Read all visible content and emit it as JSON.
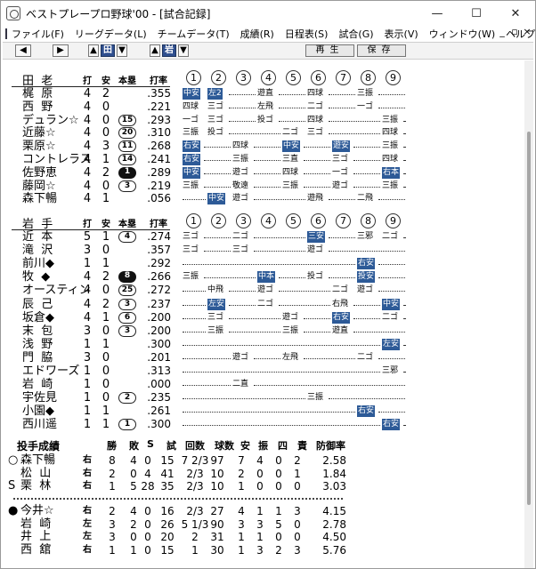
{
  "window": {
    "title": "ベストプレープロ野球'00 - [試合記録]"
  },
  "menu": [
    "ファイル(F)",
    "リーグデータ(L)",
    "チームデータ(T)",
    "成績(R)",
    "日程表(S)",
    "試合(G)",
    "表示(V)",
    "ウィンドウ(W)",
    "ヘルプ(H)"
  ],
  "toolbar": {
    "team_home": "田",
    "team_away": "岩",
    "play_label": "再生",
    "save_label": "保存"
  },
  "headers": {
    "ab": "打",
    "h": "安",
    "hr": "本塁",
    "avg": "打率"
  },
  "innings": [
    "1",
    "2",
    "3",
    "4",
    "5",
    "6",
    "7",
    "8",
    "9"
  ],
  "team1": {
    "label": "田  老",
    "rows": [
      {
        "name": "梶  原",
        "ab": "4",
        "h": "2",
        "hr": "",
        "hr_style": "",
        "avg": ".355"
      },
      {
        "name": "西  野",
        "ab": "4",
        "h": "0",
        "hr": "",
        "hr_style": "",
        "avg": ".221"
      },
      {
        "name": "デュラン☆",
        "ab": "4",
        "h": "0",
        "hr": "15",
        "hr_style": "circ",
        "avg": ".293"
      },
      {
        "name": "近藤☆",
        "ab": "4",
        "h": "0",
        "hr": "20",
        "hr_style": "circ",
        "avg": ".310"
      },
      {
        "name": "栗原☆",
        "ab": "4",
        "h": "3",
        "hr": "11",
        "hr_style": "circ",
        "avg": ".268"
      },
      {
        "name": "コントレラス",
        "ab": "4",
        "h": "1",
        "hr": "14",
        "hr_style": "circ",
        "avg": ".241"
      },
      {
        "name": "佐野恵",
        "ab": "4",
        "h": "2",
        "hr": "1",
        "hr_style": "filled",
        "avg": ".289"
      },
      {
        "name": "藤岡☆",
        "ab": "4",
        "h": "0",
        "hr": "3",
        "hr_style": "circ",
        "avg": ".219"
      },
      {
        "name": "森下暢",
        "ab": "4",
        "h": "1",
        "hr": "",
        "hr_style": "",
        "avg": ".056"
      }
    ]
  },
  "team2": {
    "label": "岩  手",
    "rows": [
      {
        "name": "近  本",
        "ab": "5",
        "h": "1",
        "hr": "4",
        "hr_style": "circ",
        "avg": ".274"
      },
      {
        "name": "滝  沢",
        "ab": "3",
        "h": "0",
        "hr": "",
        "hr_style": "",
        "avg": ".357"
      },
      {
        "name": "前川◆",
        "ab": "1",
        "h": "1",
        "hr": "",
        "hr_style": "",
        "avg": ".292"
      },
      {
        "name": "牧  ◆",
        "ab": "4",
        "h": "2",
        "hr": "8",
        "hr_style": "filled",
        "avg": ".266"
      },
      {
        "name": "オースティン",
        "ab": "4",
        "h": "0",
        "hr": "25",
        "hr_style": "circ",
        "avg": ".272"
      },
      {
        "name": "辰  己",
        "ab": "4",
        "h": "2",
        "hr": "3",
        "hr_style": "circ",
        "avg": ".237"
      },
      {
        "name": "坂倉◆",
        "ab": "4",
        "h": "1",
        "hr": "6",
        "hr_style": "circ",
        "avg": ".200"
      },
      {
        "name": "末  包",
        "ab": "3",
        "h": "0",
        "hr": "3",
        "hr_style": "circ",
        "avg": ".200"
      },
      {
        "name": "浅  野",
        "ab": "1",
        "h": "1",
        "hr": "",
        "hr_style": "",
        "avg": ".300"
      },
      {
        "name": "門  脇",
        "ab": "3",
        "h": "0",
        "hr": "",
        "hr_style": "",
        "avg": ".201"
      },
      {
        "name": "エドワーズ",
        "ab": "1",
        "h": "0",
        "hr": "",
        "hr_style": "",
        "avg": ".313"
      },
      {
        "name": "岩  崎",
        "ab": "1",
        "h": "0",
        "hr": "",
        "hr_style": "",
        "avg": ".000"
      },
      {
        "name": "宇佐見",
        "ab": "1",
        "h": "0",
        "hr": "2",
        "hr_style": "circ",
        "avg": ".235"
      },
      {
        "name": "小園◆",
        "ab": "1",
        "h": "1",
        "hr": "",
        "hr_style": "",
        "avg": ".261"
      },
      {
        "name": "西川遥",
        "ab": "1",
        "h": "1",
        "hr": "1",
        "hr_style": "circ",
        "avg": ".300"
      }
    ]
  },
  "pitching": {
    "title": "投手成績",
    "headers": [
      "勝",
      "敗",
      "S",
      "試",
      "回数",
      "球数",
      "安",
      "振",
      "四",
      "責",
      "防御率"
    ],
    "team1": [
      {
        "mark": "○",
        "name": "森下暢",
        "hand": "右",
        "w": "8",
        "l": "4",
        "s": "0",
        "g": "15",
        "ip": "7 2/3",
        "np": "97",
        "h": "7",
        "k": "4",
        "bb": "0",
        "er": "2",
        "era": "2.58"
      },
      {
        "mark": "",
        "name": "松  山",
        "hand": "右",
        "w": "2",
        "l": "0",
        "s": "4",
        "g": "41",
        "ip": "2/3",
        "np": "10",
        "h": "2",
        "k": "0",
        "bb": "0",
        "er": "1",
        "era": "1.84"
      },
      {
        "mark": "S",
        "name": "栗  林",
        "hand": "右",
        "w": "1",
        "l": "5",
        "s": "28",
        "g": "35",
        "ip": "2/3",
        "np": "10",
        "h": "1",
        "k": "0",
        "bb": "0",
        "er": "0",
        "era": "3.03"
      }
    ],
    "team2": [
      {
        "mark": "●",
        "name": "今井☆",
        "hand": "右",
        "w": "2",
        "l": "4",
        "s": "0",
        "g": "16",
        "ip": "2/3",
        "np": "27",
        "h": "4",
        "k": "1",
        "bb": "1",
        "er": "3",
        "era": "4.15"
      },
      {
        "mark": "",
        "name": "岩  崎",
        "hand": "左",
        "w": "3",
        "l": "2",
        "s": "0",
        "g": "26",
        "ip": "5 1/3",
        "np": "90",
        "h": "3",
        "k": "3",
        "bb": "5",
        "er": "0",
        "era": "2.78"
      },
      {
        "mark": "",
        "name": "井  上",
        "hand": "左",
        "w": "3",
        "l": "0",
        "s": "0",
        "g": "20",
        "ip": "2",
        "np": "31",
        "h": "1",
        "k": "1",
        "bb": "0",
        "er": "0",
        "era": "4.50"
      },
      {
        "mark": "",
        "name": "西  舘",
        "hand": "右",
        "w": "1",
        "l": "1",
        "s": "0",
        "g": "15",
        "ip": "1",
        "np": "30",
        "h": "1",
        "k": "3",
        "bb": "2",
        "er": "3",
        "era": "5.76"
      }
    ]
  },
  "at_bats_team1": [
    [
      "中安",
      "左2",
      "",
      "遊直",
      "",
      "四球",
      "",
      "三振",
      ""
    ],
    [
      "四球",
      "三ゴ",
      "",
      "左飛",
      "",
      "二ゴ",
      "",
      "一ゴ",
      ""
    ],
    [
      "一ゴ",
      "三ゴ",
      "",
      "投ゴ",
      "",
      "四球",
      "",
      "",
      "三振"
    ],
    [
      "三振",
      "投ゴ",
      "",
      "",
      "二ゴ",
      "三ゴ",
      "",
      "",
      "四球"
    ],
    [
      "右安",
      "",
      "四球",
      "",
      "中安",
      "",
      "遊安",
      "",
      "三振"
    ],
    [
      "右安",
      "",
      "三振",
      "",
      "三直",
      "",
      "三ゴ",
      "",
      "四球"
    ],
    [
      "中安",
      "",
      "遊ゴ",
      "",
      "四球",
      "",
      "一ゴ",
      "",
      "右本"
    ],
    [
      "三振",
      "",
      "敬遠",
      "",
      "三振",
      "",
      "遊ゴ",
      "",
      "三振"
    ],
    [
      "",
      "中安",
      "遊ゴ",
      "",
      "",
      "遊飛",
      "",
      "二飛",
      ""
    ]
  ],
  "at_bats_team2": [
    [
      "三ゴ",
      "",
      "二ゴ",
      "",
      "",
      "三安",
      "",
      "三邪",
      "二ゴ"
    ],
    [
      "三ゴ",
      "",
      "三ゴ",
      "",
      "",
      "遊ゴ",
      "",
      "",
      ""
    ],
    [
      "",
      "",
      "",
      "",
      "",
      "",
      "",
      "右安",
      ""
    ],
    [
      "三振",
      "",
      "",
      "中本",
      "",
      "投ゴ",
      "",
      "投安",
      ""
    ],
    [
      "",
      "中飛",
      "",
      "遊ゴ",
      "",
      "",
      "二ゴ",
      "遊ゴ",
      ""
    ],
    [
      "",
      "左安",
      "",
      "二ゴ",
      "",
      "",
      "右飛",
      "",
      "中安"
    ],
    [
      "",
      "三ゴ",
      "",
      "",
      "遊ゴ",
      "",
      "右安",
      "",
      "二ゴ"
    ],
    [
      "",
      "三振",
      "",
      "",
      "三振",
      "",
      "遊直",
      "",
      ""
    ],
    [
      "",
      "",
      "",
      "",
      "",
      "",
      "",
      "",
      "左安"
    ],
    [
      "",
      "",
      "遊ゴ",
      "",
      "左飛",
      "",
      "",
      "二ゴ",
      ""
    ],
    [
      "",
      "",
      "",
      "",
      "",
      "",
      "",
      "",
      "三邪"
    ],
    [
      "",
      "",
      "二直",
      "",
      "",
      "",
      "",
      "",
      ""
    ],
    [
      "",
      "",
      "",
      "",
      "",
      "三振",
      "",
      "",
      ""
    ],
    [
      "",
      "",
      "",
      "",
      "",
      "",
      "",
      "右安",
      ""
    ],
    [
      "",
      "",
      "",
      "",
      "",
      "",
      "",
      "",
      "右安"
    ]
  ]
}
